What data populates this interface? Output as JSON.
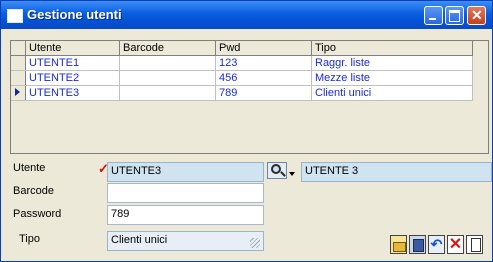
{
  "window": {
    "title": "Gestione utenti",
    "accent": "#0a5ee0"
  },
  "grid": {
    "columns": [
      "Utente",
      "Barcode",
      "Pwd",
      "Tipo"
    ],
    "rows": [
      {
        "utente": "UTENTE1",
        "barcode": "",
        "pwd": "123",
        "tipo": "Raggr. liste",
        "selected": false
      },
      {
        "utente": "UTENTE2",
        "barcode": "",
        "pwd": "456",
        "tipo": "Mezze liste",
        "selected": false
      },
      {
        "utente": "UTENTE3",
        "barcode": "",
        "pwd": "789",
        "tipo": "Clienti unici",
        "selected": true
      }
    ]
  },
  "form": {
    "utente_label": "Utente",
    "utente_value": "UTENTE3",
    "utente_description": "UTENTE 3",
    "barcode_label": "Barcode",
    "barcode_value": "",
    "password_label": "Password",
    "password_value": "789",
    "tipo_label": "Tipo",
    "tipo_value": "Clienti unici"
  },
  "icons": {
    "check": "check-icon",
    "lookup": "search-icon",
    "toolbar": [
      "open-folder-icon",
      "save-icon",
      "undo-icon",
      "delete-icon",
      "new-document-icon"
    ]
  }
}
